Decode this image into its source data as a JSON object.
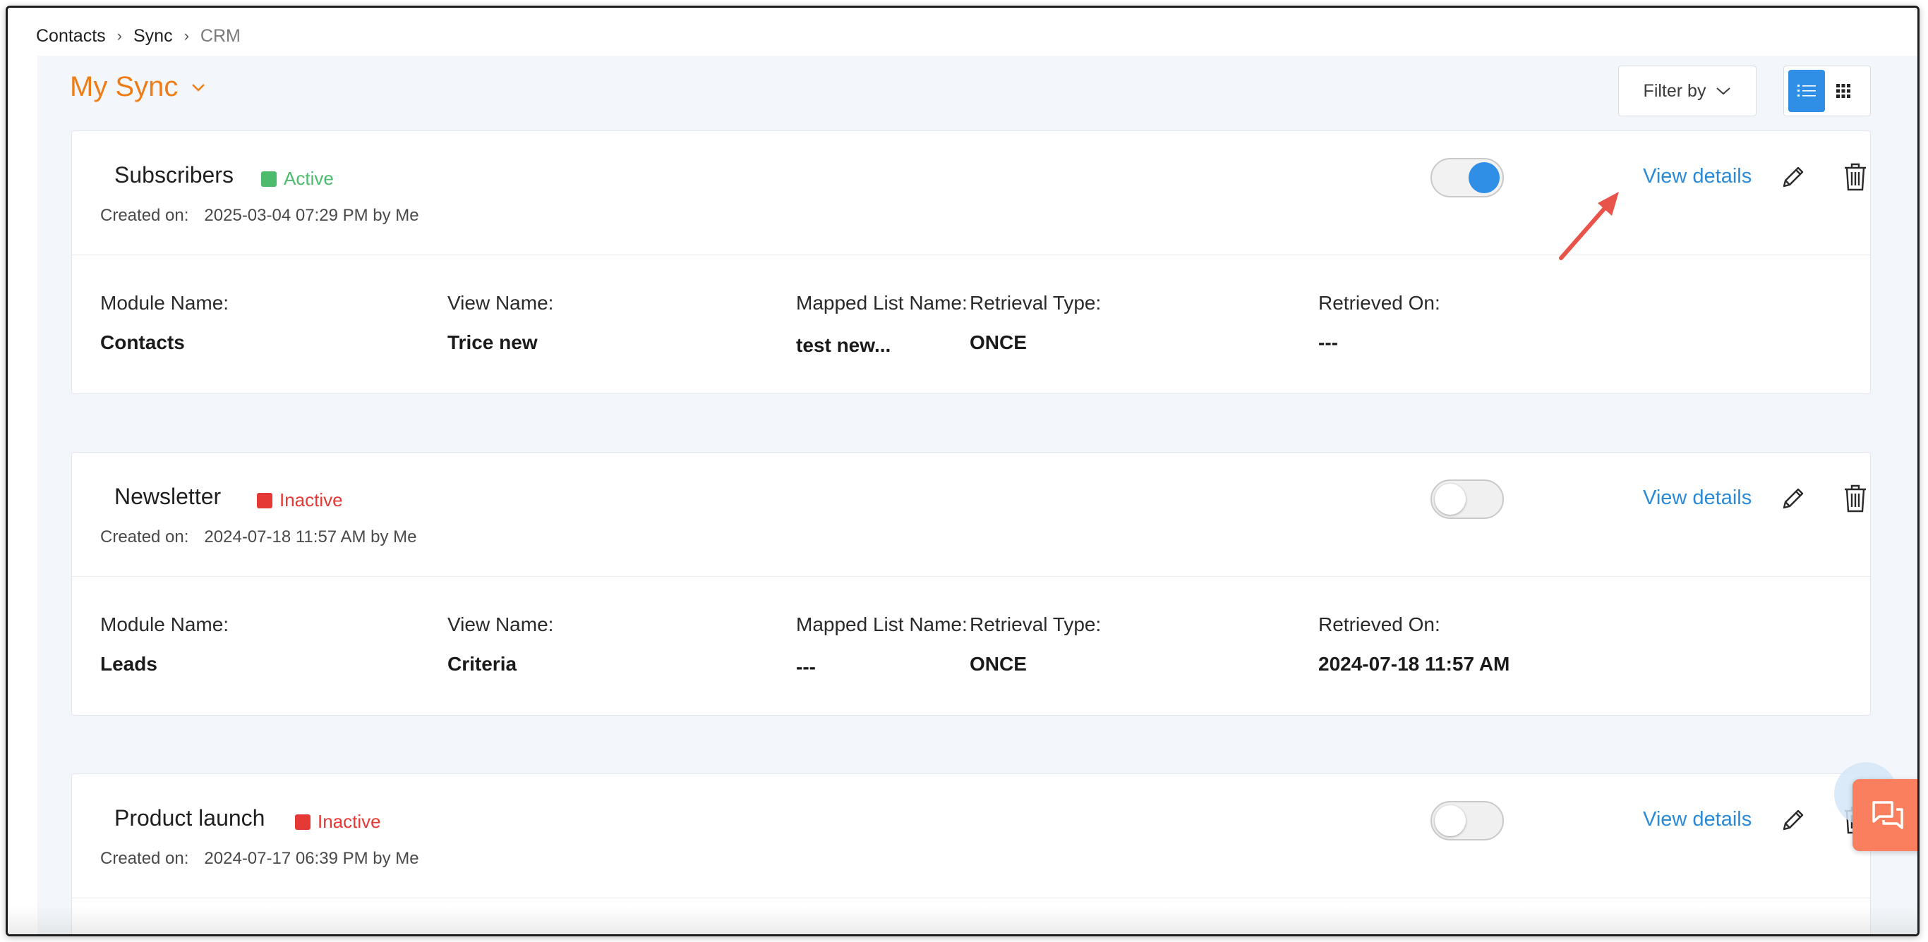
{
  "breadcrumb": [
    "Contacts",
    "Sync",
    "CRM"
  ],
  "header": {
    "title": "My Sync",
    "filter_label": "Filter by"
  },
  "labels": {
    "created_on": "Created on:",
    "view_details": "View details",
    "module_name": "Module Name:",
    "view_name": "View Name:",
    "mapped_list_name": "Mapped List Name:",
    "retrieval_type": "Retrieval Type:",
    "retrieved_on": "Retrieved On:"
  },
  "colors": {
    "accent": "#ef7d17",
    "link": "#2b8ad6",
    "active": "#4cbb6c",
    "inactive": "#e53935",
    "toggle_on": "#2f8fe6",
    "chat": "#f97f5f"
  },
  "syncs": [
    {
      "name": "Subscribers",
      "status": "Active",
      "enabled": true,
      "created": "2025-03-04 07:29 PM by Me",
      "module_name": "Contacts",
      "view_name": "Trice new",
      "mapped_list_name": "test new...",
      "retrieval_type": "ONCE",
      "retrieved_on": "---"
    },
    {
      "name": "Newsletter",
      "status": "Inactive",
      "enabled": false,
      "created": "2024-07-18 11:57 AM by Me",
      "module_name": "Leads",
      "view_name": "Criteria",
      "mapped_list_name": "---",
      "retrieval_type": "ONCE",
      "retrieved_on": "2024-07-18 11:57 AM"
    },
    {
      "name": "Product launch",
      "status": "Inactive",
      "enabled": false,
      "created": "2024-07-17 06:39 PM by Me"
    }
  ]
}
